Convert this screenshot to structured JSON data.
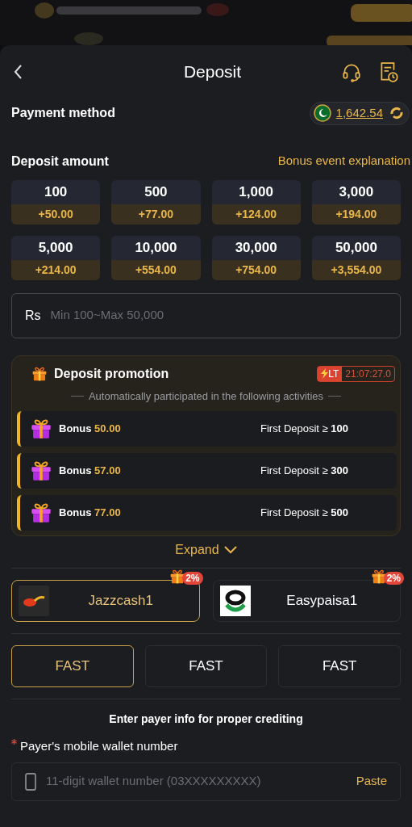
{
  "header": {
    "title": "Deposit"
  },
  "payment_method": {
    "label": "Payment method",
    "balance": "1,642.54"
  },
  "deposit_amount": {
    "label": "Deposit amount",
    "link": "Bonus event explanation"
  },
  "amounts": [
    {
      "amount": "100",
      "bonus": "+50.00"
    },
    {
      "amount": "500",
      "bonus": "+77.00"
    },
    {
      "amount": "1,000",
      "bonus": "+124.00"
    },
    {
      "amount": "3,000",
      "bonus": "+194.00"
    },
    {
      "amount": "5,000",
      "bonus": "+214.00"
    },
    {
      "amount": "10,000",
      "bonus": "+554.00"
    },
    {
      "amount": "30,000",
      "bonus": "+754.00"
    },
    {
      "amount": "50,000",
      "bonus": "+3,554.00"
    }
  ],
  "amount_field": {
    "currency": "Rs",
    "placeholder": "Min 100~Max 50,000"
  },
  "promotion": {
    "title": "Deposit promotion",
    "badge": "LT",
    "timer": "21:07:27.0",
    "subtitle": "Automatically participated in the following activities",
    "expand": "Expand",
    "items": [
      {
        "label": "Bonus",
        "amount": "50.00",
        "condition": "First Deposit ≥ **100**"
      },
      {
        "label": "Bonus",
        "amount": "57.00",
        "condition": "First Deposit ≥ **300**"
      },
      {
        "label": "Bonus",
        "amount": "77.00",
        "condition": "First Deposit ≥ **500**"
      }
    ]
  },
  "channels": [
    {
      "name": "Jazzcash1",
      "badge": "2%",
      "selected": true,
      "kind": "jazzcash"
    },
    {
      "name": "Easypaisa1",
      "badge": "2%",
      "selected": false,
      "kind": "easypaisa"
    }
  ],
  "speeds": [
    {
      "label": "FAST",
      "selected": true
    },
    {
      "label": "FAST",
      "selected": false
    },
    {
      "label": "FAST",
      "selected": false
    }
  ],
  "payer": {
    "note": "Enter payer info for proper crediting",
    "label": "Payer's mobile wallet number",
    "required": true,
    "placeholder": "11-digit wallet number (03XXXXXXXXX)",
    "paste": "Paste"
  }
}
